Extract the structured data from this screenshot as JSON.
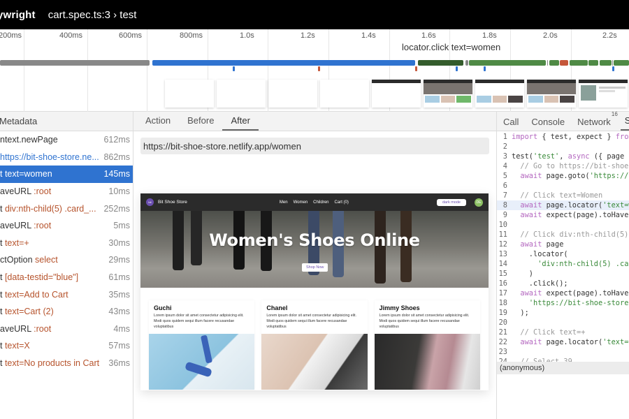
{
  "header": {
    "brand": "Playwright",
    "brand_visible": "ywright",
    "breadcrumb": "cart.spec.ts:3 › test"
  },
  "timeline": {
    "ticks": [
      "200ms",
      "400ms",
      "600ms",
      "800ms",
      "1.0s",
      "1.2s",
      "1.4s",
      "1.6s",
      "1.8s",
      "2.0s",
      "2.2s"
    ],
    "hover_label": "locator.click text=women",
    "thumbnail_count": 9
  },
  "actions_panel": {
    "header": "Metadata",
    "items": [
      {
        "name": "ntext.newPage",
        "selector": "",
        "duration": "612ms",
        "type": "normal"
      },
      {
        "name": "https://bit-shoe-store.ne...",
        "selector": "",
        "duration": "862ms",
        "type": "url"
      },
      {
        "name": "t text=women",
        "selector": "",
        "duration": "145ms",
        "type": "active"
      },
      {
        "name": "aveURL ",
        "selector": ":root",
        "duration": "10ms",
        "type": "normal"
      },
      {
        "name": "t ",
        "selector": "div:nth-child(5) .card_...",
        "duration": "252ms",
        "type": "normal"
      },
      {
        "name": "aveURL ",
        "selector": ":root",
        "duration": "5ms",
        "type": "normal"
      },
      {
        "name": "t ",
        "selector": "text=+",
        "duration": "30ms",
        "type": "normal"
      },
      {
        "name": "ctOption ",
        "selector": "select",
        "duration": "29ms",
        "type": "normal"
      },
      {
        "name": "t ",
        "selector": "[data-testid=\"blue\"]",
        "duration": "61ms",
        "type": "normal"
      },
      {
        "name": "t ",
        "selector": "text=Add to Cart",
        "duration": "35ms",
        "type": "normal"
      },
      {
        "name": "t ",
        "selector": "text=Cart (2)",
        "duration": "43ms",
        "type": "normal"
      },
      {
        "name": "aveURL ",
        "selector": ":root",
        "duration": "4ms",
        "type": "normal"
      },
      {
        "name": "t ",
        "selector": "text=X",
        "duration": "57ms",
        "type": "normal"
      },
      {
        "name": "t ",
        "selector": "text=No products in Cart",
        "duration": "36ms",
        "type": "normal"
      }
    ]
  },
  "snapshot_panel": {
    "tabs": [
      "Action",
      "Before",
      "After"
    ],
    "selected_tab": "After",
    "url": "https://bit-shoe-store.netlify.app/women",
    "page": {
      "logo_text": "bit",
      "store_name": "Bit Shoe Store",
      "nav": [
        "Men",
        "Women",
        "Children",
        "Cart (0)"
      ],
      "dark_mode_button": "dark mode",
      "avatar": "DE",
      "hero_title": "Women's Shoes Online",
      "hero_button": "Shop Now",
      "products": [
        {
          "name": "Guchi",
          "description": "Lorem ipsum dolor sit amet consectetur adipisicing elit. Modi quos quidem sequi illum facere recusandae voluptatibus"
        },
        {
          "name": "Chanel",
          "description": "Lorem ipsum dolor sit amet consectetur adipisicing elit. Modi quos quidem sequi illum facere recusandae voluptatibus"
        },
        {
          "name": "Jimmy Shoes",
          "description": "Lorem ipsum dolor sit amet consectetur adipisicing elit. Modi quos quidem sequi illum facere recusandae voluptatibus"
        }
      ]
    }
  },
  "source_panel": {
    "tabs": [
      "Call",
      "Console",
      "Network",
      "S"
    ],
    "network_count": "16",
    "selected_tab": "S",
    "highlighted_line": 8,
    "lines": [
      "import { test, expect } from",
      "",
      "test('test', async ({ page })",
      "  // Go to https://bit-shoe-s",
      "  await page.goto('https://bi",
      "",
      "  // Click text=Women",
      "  await page.locator('text=wo",
      "  await expect(page).toHaveUR",
      "",
      "  // Click div:nth-child(5) .",
      "  await page",
      "    .locator(",
      "      'div:nth-child(5) .card",
      "    )",
      "    .click();",
      "  await expect(page).toHaveUR",
      "    'https://bit-shoe-store.n",
      "  );",
      "",
      "  // Click text=+",
      "  await page.locator('text=+'",
      "",
      "  // Select 39"
    ],
    "stack_frame": "(anonymous)"
  },
  "colors": {
    "accent": "#2f73d0",
    "selector": "#b6532c",
    "header_bg": "#000000"
  }
}
